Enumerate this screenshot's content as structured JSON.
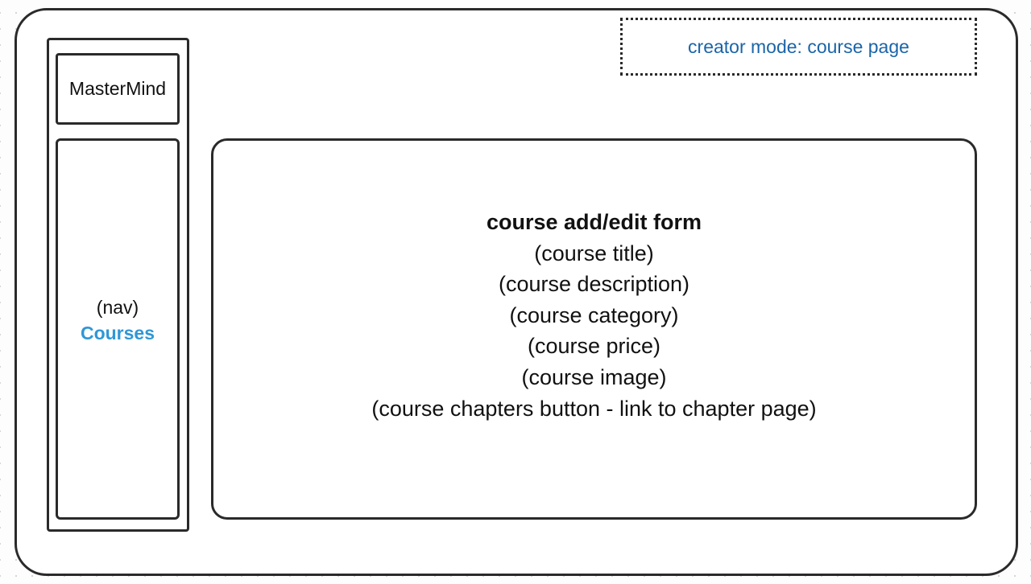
{
  "sidebar": {
    "brand": "MasterMind",
    "nav_label": "(nav)",
    "nav_items": [
      "Courses"
    ]
  },
  "mode_badge": {
    "text": "creator mode: course page"
  },
  "form": {
    "title": "course add/edit form",
    "fields": [
      "(course title)",
      "(course description)",
      "(course category)",
      "(course price)",
      "(course image)",
      "(course chapters button - link to chapter page)"
    ]
  },
  "colors": {
    "link": "#2f97d6",
    "mode_text": "#1b64a8",
    "outline": "#2a2a2a"
  }
}
